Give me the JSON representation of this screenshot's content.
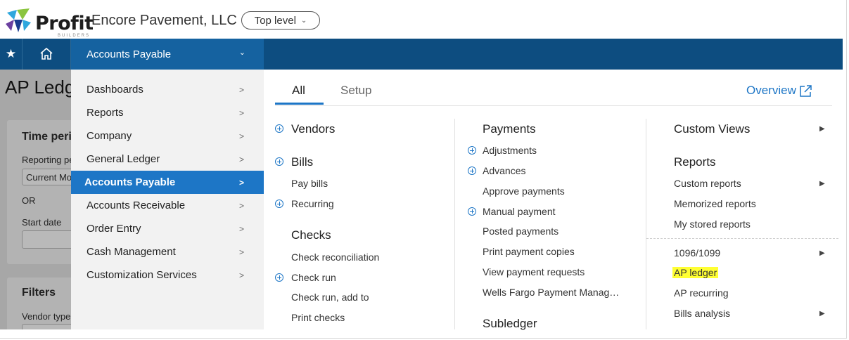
{
  "header": {
    "logo_text": "Profit",
    "logo_subtext": "BUILDERS",
    "company": "Encore Pavement, LLC",
    "level_button": "Top level"
  },
  "nav": {
    "module": "Accounts Payable"
  },
  "background_page": {
    "title": "AP Ledger",
    "time_period": "Time period",
    "reporting": "Reporting period",
    "reporting_value": "Current Month",
    "or": "OR",
    "start_date": "Start date",
    "filters": "Filters",
    "vendor_type": "Vendor type"
  },
  "left_menu": [
    {
      "label": "Dashboards"
    },
    {
      "label": "Reports"
    },
    {
      "label": "Company"
    },
    {
      "label": "General Ledger"
    },
    {
      "label": "Accounts Payable",
      "active": true
    },
    {
      "label": "Accounts Receivable"
    },
    {
      "label": "Order Entry"
    },
    {
      "label": "Cash Management"
    },
    {
      "label": "Customization Services"
    }
  ],
  "tabs": [
    "All",
    "Setup"
  ],
  "overview": "Overview",
  "col1": {
    "vendors": "Vendors",
    "bills": "Bills",
    "pay_bills": "Pay bills",
    "recurring": "Recurring",
    "checks": "Checks",
    "check_reconciliation": "Check reconciliation",
    "check_run": "Check run",
    "check_run_add": "Check run, add to",
    "print_checks": "Print checks"
  },
  "col2": {
    "payments": "Payments",
    "adjustments": "Adjustments",
    "advances": "Advances",
    "approve_payments": "Approve payments",
    "manual_payment": "Manual payment",
    "posted_payments": "Posted payments",
    "print_payment_copies": "Print payment copies",
    "view_payment_requests": "View payment requests",
    "wells_fargo": "Wells Fargo Payment Manag…",
    "subledger": "Subledger"
  },
  "col3": {
    "custom_views": "Custom Views",
    "reports": "Reports",
    "custom_reports": "Custom reports",
    "memorized_reports": "Memorized reports",
    "my_stored_reports": "My stored reports",
    "form_1096": "1096/1099",
    "ap_ledger": "AP ledger",
    "ap_recurring": "AP recurring",
    "bills_analysis": "Bills analysis"
  },
  "colors": {
    "nav_bg": "#0d4d80",
    "module_bg": "#1562a0",
    "active_item": "#1d76c6",
    "highlight": "#ffff33"
  }
}
